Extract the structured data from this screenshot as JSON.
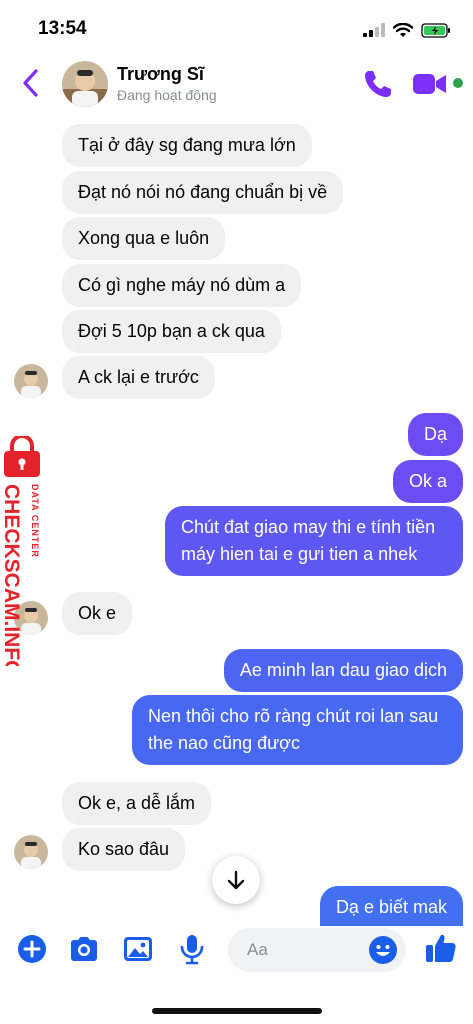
{
  "status_bar": {
    "time": "13:54"
  },
  "header": {
    "contact_name": "Trương Sĩ",
    "presence": "Đang hoạt động"
  },
  "colors": {
    "accent": "#7b2ff7",
    "in_bubble": "#f0f0f0",
    "out_gradient_top": "#6b4cf5",
    "out_gradient_bottom": "#4270f0",
    "online": "#31a24c",
    "composer_blue": "#1a5de8"
  },
  "messages": [
    {
      "dir": "in",
      "text": "Tại ở đây sg đang mưa lớn"
    },
    {
      "dir": "in",
      "text": "Đạt nó nói nó đang chuẩn bị về"
    },
    {
      "dir": "in",
      "text": "Xong qua e luôn"
    },
    {
      "dir": "in",
      "text": "Có gì nghe máy nó dùm a"
    },
    {
      "dir": "in",
      "text": "Đợi 5 10p bạn a ck qua"
    },
    {
      "dir": "in",
      "text": "A ck lại e trước"
    },
    {
      "dir": "out",
      "text": "Dạ"
    },
    {
      "dir": "out",
      "text": "Ok a"
    },
    {
      "dir": "out",
      "text": "Chút đat giao may thi e tính tiền",
      "text2": "máy hien tai e gưi tien a nhek"
    },
    {
      "dir": "in",
      "text": "Ok e"
    },
    {
      "dir": "out",
      "text": "Ae minh lan dau giao dịch"
    },
    {
      "dir": "out",
      "text": "Nen thôi cho rõ ràng chút roi lan sau",
      "text2": "the nao cũng được"
    },
    {
      "dir": "in",
      "text": "Ok e, a dễ lắm"
    },
    {
      "dir": "in",
      "text": "Ko sao đâu"
    },
    {
      "dir": "out",
      "text": "Dạ e biết mak"
    }
  ],
  "watermark": {
    "brand": "CHECKSCAM.INFO",
    "sub": "DATA CENTER"
  },
  "composer": {
    "placeholder": "Aa"
  },
  "icons": [
    "back-chevron-icon",
    "phone-icon",
    "video-camera-icon",
    "plus-icon",
    "camera-icon",
    "image-icon",
    "microphone-icon",
    "emoji-icon",
    "thumbs-up-icon",
    "arrow-down-icon"
  ]
}
